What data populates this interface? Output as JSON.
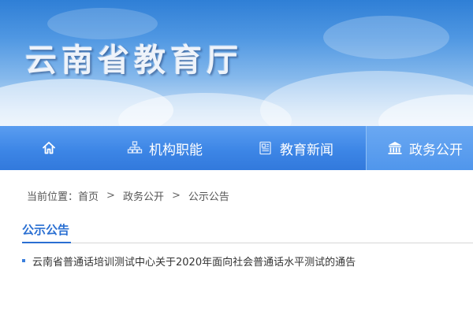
{
  "header": {
    "site_title": "云南省教育厅"
  },
  "nav": {
    "items": [
      {
        "icon": "home-icon",
        "label": ""
      },
      {
        "icon": "org-chart-icon",
        "label": "机构职能"
      },
      {
        "icon": "newspaper-icon",
        "label": "教育新闻"
      },
      {
        "icon": "government-building-icon",
        "label": "政务公开",
        "active": true
      }
    ]
  },
  "breadcrumb": {
    "prefix": "当前位置：",
    "items": [
      "首页",
      "政务公开",
      "公示公告"
    ],
    "separator": ">"
  },
  "section": {
    "title": "公示公告",
    "articles": [
      {
        "title": "云南省普通话培训测试中心关于2020年面向社会普通话水平测试的通告"
      }
    ]
  },
  "colors": {
    "nav_bg": "#3d86e6",
    "accent": "#2a6fd2",
    "text": "#333333"
  }
}
